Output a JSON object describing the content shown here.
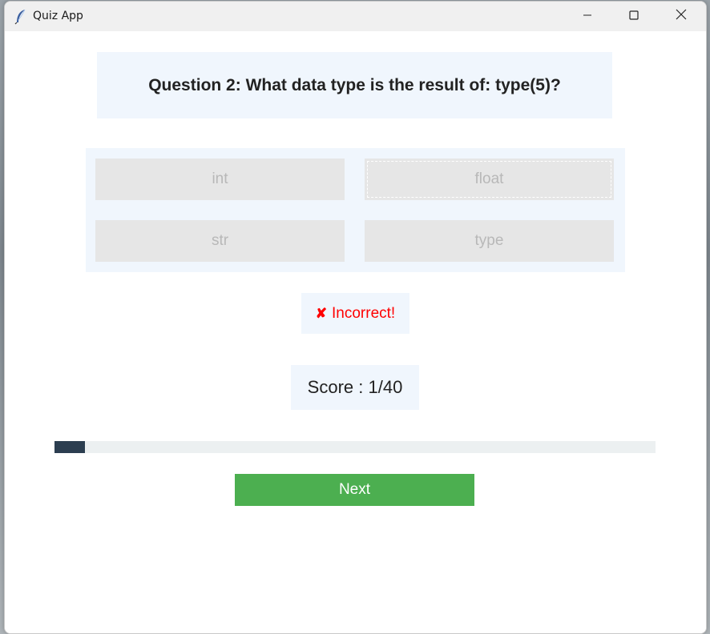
{
  "window": {
    "title": "Quiz App"
  },
  "question": {
    "text": "Question 2: What data type is the result of: type(5)?"
  },
  "options": [
    {
      "label": "int"
    },
    {
      "label": "float"
    },
    {
      "label": "str"
    },
    {
      "label": "type"
    }
  ],
  "feedback": {
    "icon": "✘",
    "text": "Incorrect!"
  },
  "score": {
    "text": "Score : 1/40"
  },
  "progress": {
    "fraction": 0.05
  },
  "next_button": {
    "label": "Next"
  },
  "colors": {
    "panel_bg": "#f0f6fd",
    "feedback": "#ff0000",
    "progress_fill": "#2c3e50",
    "progress_track": "#ecf0f1",
    "next_button": "#4caf50"
  },
  "icons": {
    "app": "feather-icon",
    "minimize": "minimize-icon",
    "maximize": "maximize-icon",
    "close": "close-icon"
  }
}
